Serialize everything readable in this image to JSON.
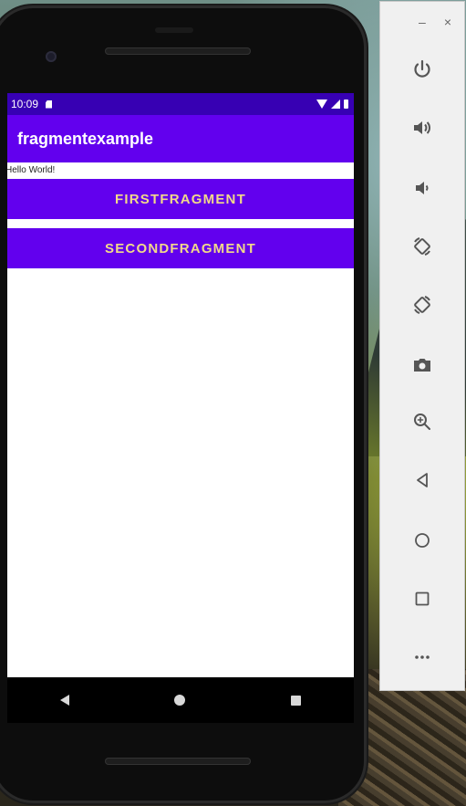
{
  "status_bar": {
    "time": "10:09"
  },
  "app_bar": {
    "title": "fragmentexample"
  },
  "content": {
    "hello_text": "Hello World!",
    "first_button_label": "FIRSTFRAGMENT",
    "second_button_label": "SECONDFRAGMENT"
  },
  "window_controls": {
    "minimize": "–",
    "close": "×"
  },
  "toolbar": {
    "items": [
      {
        "icon": "power-icon"
      },
      {
        "icon": "volume-up-icon"
      },
      {
        "icon": "volume-down-icon"
      },
      {
        "icon": "rotate-left-icon"
      },
      {
        "icon": "rotate-right-icon"
      },
      {
        "icon": "camera-icon"
      },
      {
        "icon": "zoom-in-icon"
      },
      {
        "icon": "back-icon"
      },
      {
        "icon": "home-icon"
      },
      {
        "icon": "overview-icon"
      },
      {
        "icon": "more-icon"
      }
    ]
  },
  "colors": {
    "status_bar": "#3700b3",
    "primary": "#6200ee",
    "button_text": "#f2d98a",
    "toolbar_bg": "#f0f0f0",
    "toolbar_icon": "#555555"
  }
}
